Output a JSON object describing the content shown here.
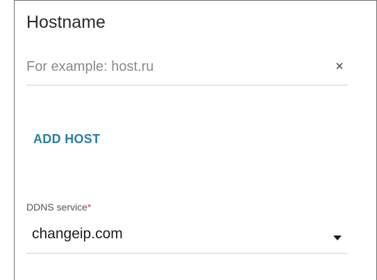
{
  "hostname_section": {
    "title": "Hostname",
    "input_value": "",
    "input_placeholder": "For example: host.ru",
    "clear_icon": "close-icon"
  },
  "add_host": {
    "label": "ADD HOST"
  },
  "ddns": {
    "label": "DDNS service",
    "required_marker": "*",
    "selected_value": "changeip.com",
    "dropdown_icon": "caret-down-icon"
  },
  "colors": {
    "accent": "#2a7ea0",
    "required": "#d43b3b",
    "text": "#2a2a2a",
    "placeholder": "#8a8a8a",
    "divider": "#cfcfcf"
  }
}
